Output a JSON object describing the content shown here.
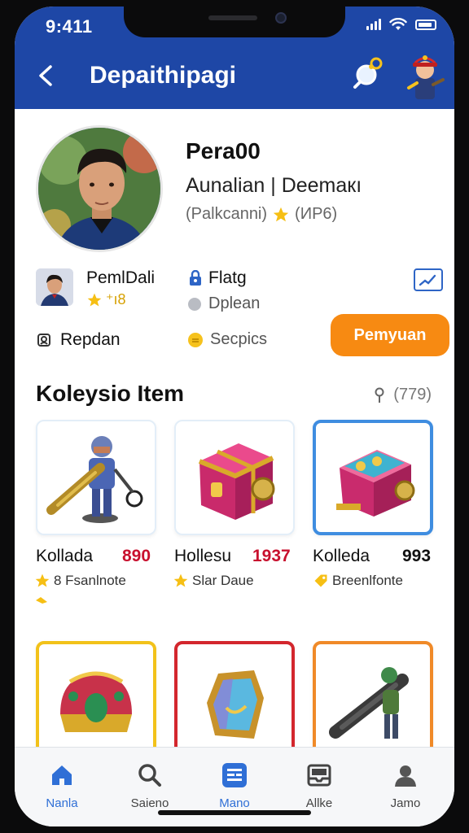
{
  "status": {
    "time": "9:411"
  },
  "header": {
    "title": "Depaithipagi"
  },
  "profile": {
    "username": "Pera00",
    "real_name": "Aunalian | Deemaкı",
    "rank_text": "(Palkcanni)",
    "rank_code": "(ИР6)"
  },
  "info": {
    "owner_name": "PemlDali",
    "owner_stat": "⁺ı8",
    "flag_label": "Flatg",
    "option_label": "Dplean"
  },
  "actions": {
    "report_label": "Repdan",
    "species_label": "Secpics",
    "cta_label": "Pemyuan"
  },
  "collection": {
    "title": "Koleysio Item",
    "count": "(779)",
    "items": [
      {
        "name": "Kollada",
        "price": "890",
        "price_color": "#c8102e",
        "sub": "8 Fsanlnote"
      },
      {
        "name": "Hollesu",
        "price": "1937",
        "price_color": "#c8102e",
        "sub": "Slar Daue"
      },
      {
        "name": "Kolleda",
        "price": "993",
        "price_color": "#111111",
        "sub": "Breenlfonte"
      }
    ]
  },
  "nav": {
    "items": [
      {
        "label": "Nanla",
        "icon": "home-icon"
      },
      {
        "label": "Saieno",
        "icon": "search-icon"
      },
      {
        "label": "Mano",
        "icon": "menu-icon"
      },
      {
        "label": "Allke",
        "icon": "inbox-icon"
      },
      {
        "label": "Jamo",
        "icon": "profile-icon"
      }
    ]
  },
  "colors": {
    "header_blue": "#1e47a6",
    "accent_orange": "#f78a12",
    "select_blue": "#3f8de0",
    "nav_active": "#2f6fd6"
  }
}
